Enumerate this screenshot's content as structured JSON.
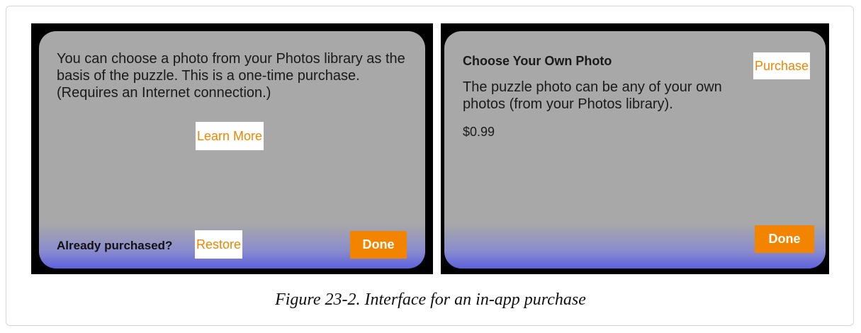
{
  "left_screen": {
    "description": "You can choose a photo from your Photos library as the basis of the puzzle. This is a one-time purchase. (Requires an Internet connection.)",
    "learn_more_label": "Learn More",
    "already_purchased_label": "Already purchased?",
    "restore_label": "Restore",
    "done_label": "Done"
  },
  "right_screen": {
    "title": "Choose Your Own Photo",
    "purchase_label": "Purchase",
    "description": "The puzzle photo can be any of your own photos (from your Photos library).",
    "price": "$0.99",
    "done_label": "Done"
  },
  "caption": "Figure 23-2. Interface for an in-app purchase",
  "colors": {
    "accent": "#f28400",
    "panel_gray": "#a8a8a8",
    "panel_gradient_bottom": "#4b50e3"
  }
}
